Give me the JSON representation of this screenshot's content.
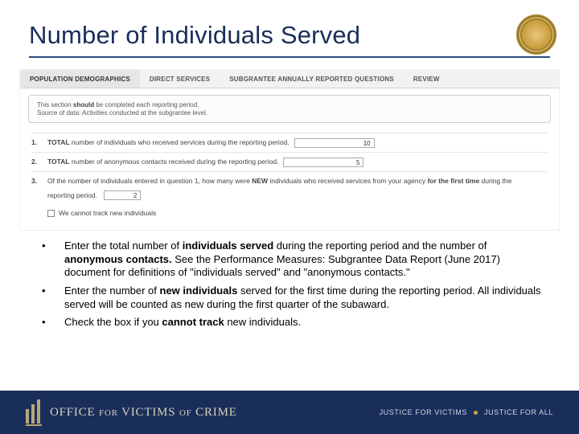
{
  "title": "Number of Individuals Served",
  "seal_name": "doj-seal",
  "screenshot": {
    "tabs": [
      {
        "label": "POPULATION DEMOGRAPHICS",
        "active": true
      },
      {
        "label": "DIRECT SERVICES",
        "active": false
      },
      {
        "label": "SUBGRANTEE ANNUALLY REPORTED QUESTIONS",
        "active": false
      },
      {
        "label": "REVIEW",
        "active": false
      }
    ],
    "infobox": {
      "line1_pre": "This section ",
      "line1_bold": "should",
      "line1_post": " be completed each reporting period.",
      "line2": "Source of data: Activities conducted at the subgrantee level."
    },
    "questions": {
      "q1": {
        "num": "1.",
        "bold": "TOTAL",
        "text": " number of individuals who received services during the reporting period.",
        "value": "10"
      },
      "q2": {
        "num": "2.",
        "bold": "TOTAL",
        "text": " number of anonymous contacts received during the reporting period.",
        "value": "5"
      },
      "q3": {
        "num": "3.",
        "text_a": "Of the number of individuals entered in question 1, how many were ",
        "bold_a": "NEW",
        "text_b": " individuals who received services from your agency ",
        "bold_b": "for the first time",
        "text_c": " during the",
        "cont": "reporting period.",
        "value": "2"
      },
      "checkbox_label": "We cannot track new individuals"
    }
  },
  "bullets": {
    "b1": {
      "pre": "Enter the total number of ",
      "bold1": "individuals served ",
      "mid1": "during the reporting period and the number of ",
      "bold2": "anonymous contacts. ",
      "mid2": "See the Performance Measures: Subgrantee Data Report (June 2017) document for definitions of \"individuals served\" and \"anonymous contacts.\""
    },
    "b2": {
      "pre": "Enter the number of ",
      "bold": "new individuals ",
      "post": "served for the first time during the reporting period. All individuals served will be counted as new during the first quarter of the subaward."
    },
    "b3": {
      "pre": "Check the box if you ",
      "bold": "cannot track",
      "post": " new individuals."
    }
  },
  "footer": {
    "logo_office": "OFFICE ",
    "logo_for": "FOR",
    "logo_victims": " VICTIMS ",
    "logo_of": "OF",
    "logo_crime": " CRIME",
    "tag_left": "JUSTICE FOR VICTIMS",
    "tag_right": "JUSTICE FOR ALL"
  }
}
